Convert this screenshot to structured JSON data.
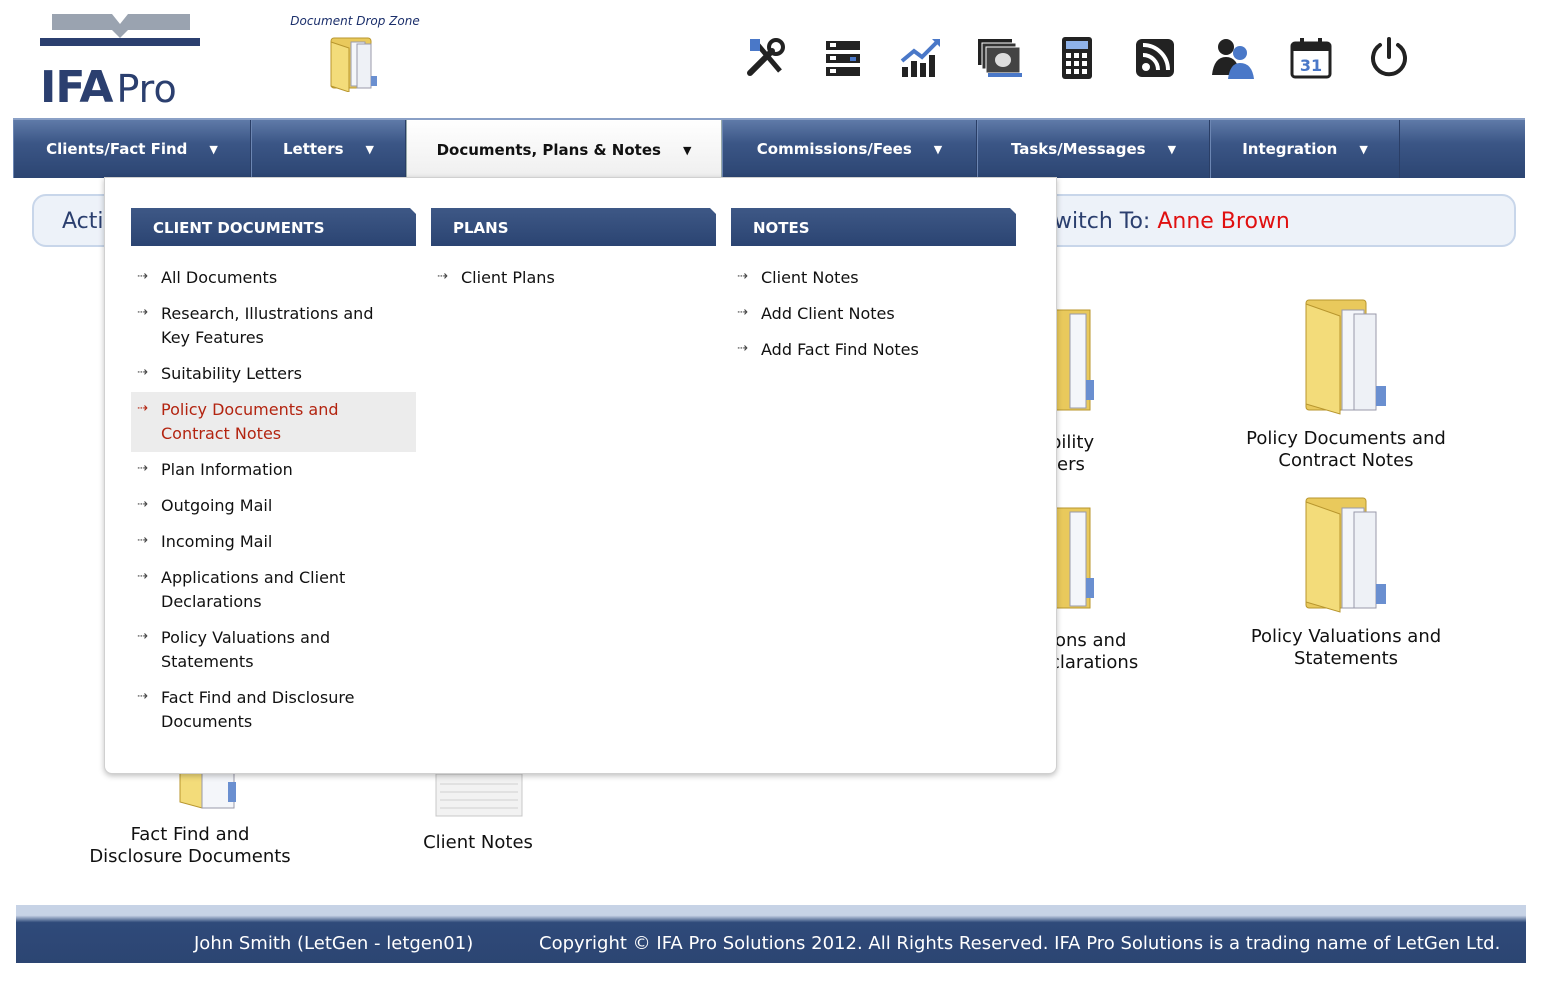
{
  "header": {
    "logo_ifa": "IFA",
    "logo_pro": "Pro",
    "drop_zone_label": "Document Drop Zone"
  },
  "toolbar": [
    "tools-icon",
    "server-icon",
    "chart-icon",
    "money-icon",
    "calculator-icon",
    "rss-icon",
    "users-icon",
    "calendar-icon",
    "power-icon"
  ],
  "nav": {
    "items": [
      {
        "label": "Clients/Fact Find"
      },
      {
        "label": "Letters"
      },
      {
        "label": "Documents, Plans & Notes"
      },
      {
        "label": "Commissions/Fees"
      },
      {
        "label": "Tasks/Messages"
      },
      {
        "label": "Integration"
      }
    ]
  },
  "client_bar": {
    "active_prefix": "Activ",
    "switch_prefix": "witch To: ",
    "switch_name": "Anne Brown"
  },
  "background_tiles": {
    "suitability_line1": "bility",
    "suitability_line2": "ters",
    "applications_line1": "ions and",
    "applications_line2": "clarations",
    "policy_docs_line1": "Policy Documents and",
    "policy_docs_line2": "Contract Notes",
    "policy_vals_line1": "Policy Valuations and",
    "policy_vals_line2": "Statements",
    "fact_find_line1": "Fact Find and",
    "fact_find_line2": "Disclosure Documents",
    "client_notes": "Client Notes"
  },
  "dropdown": {
    "client_documents": {
      "heading": "CLIENT DOCUMENTS",
      "items": [
        {
          "line1": "All Documents",
          "line2": ""
        },
        {
          "line1": "Research, Illustrations and",
          "line2": "Key Features"
        },
        {
          "line1": "Suitability Letters",
          "line2": ""
        },
        {
          "line1": "Policy Documents and",
          "line2": "Contract Notes"
        },
        {
          "line1": "Plan Information",
          "line2": ""
        },
        {
          "line1": "Outgoing Mail",
          "line2": ""
        },
        {
          "line1": "Incoming Mail",
          "line2": ""
        },
        {
          "line1": "Applications and Client",
          "line2": "Declarations"
        },
        {
          "line1": "Policy Valuations and",
          "line2": "Statements"
        },
        {
          "line1": "Fact Find and Disclosure",
          "line2": "Documents"
        }
      ]
    },
    "plans": {
      "heading": "PLANS",
      "items": [
        {
          "line1": "Client Plans"
        }
      ]
    },
    "notes": {
      "heading": "NOTES",
      "items": [
        {
          "line1": "Client Notes"
        },
        {
          "line1": "Add Client Notes"
        },
        {
          "line1": "Add Fact Find Notes"
        }
      ]
    }
  },
  "footer": {
    "user": "John Smith (LetGen - letgen01)",
    "copyright": "Copyright © IFA Pro Solutions 2012. All Rights Reserved. IFA Pro Solutions is a trading name of LetGen Ltd."
  },
  "colors": {
    "nav_blue": "#2c4572",
    "highlight_red": "#b32410",
    "name_red": "#e01010"
  }
}
